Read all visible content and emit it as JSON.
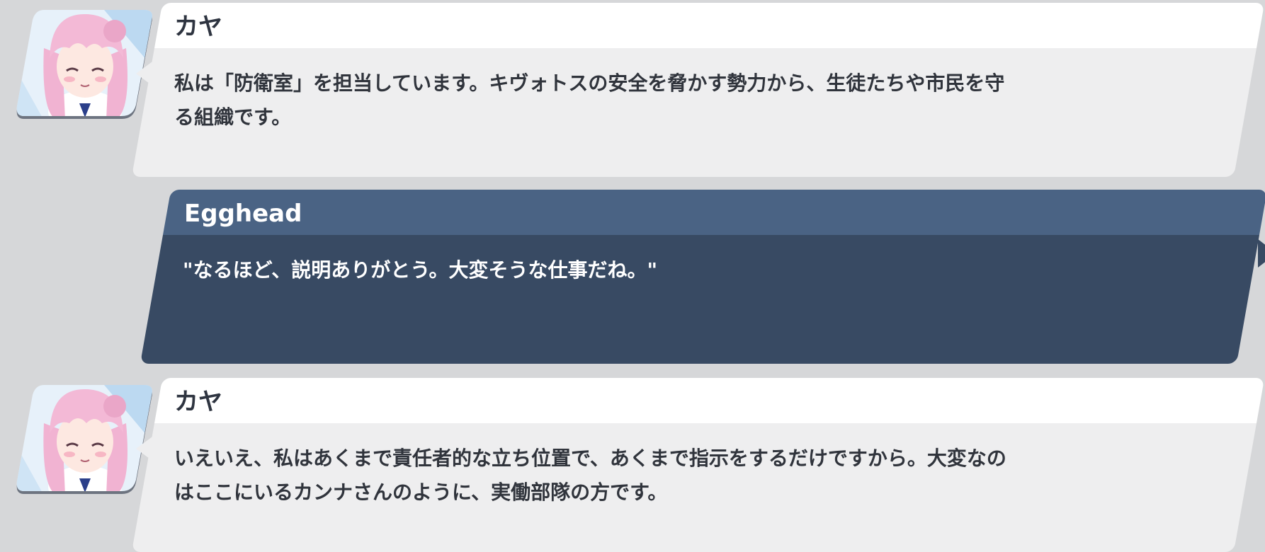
{
  "conversation": {
    "messages": [
      {
        "speaker": "カヤ",
        "role": "npc",
        "avatar_icon": "kaya-portrait-icon",
        "lines": [
          "私は「防衛室」を担当しています。キヴォトスの安全を脅かす勢力から、生徒たちや市民を守",
          "る組織です。"
        ]
      },
      {
        "speaker": "Egghead",
        "role": "player",
        "lines": [
          "\"なるほど、説明ありがとう。大変そうな仕事だね。\""
        ]
      },
      {
        "speaker": "カヤ",
        "role": "npc",
        "avatar_icon": "kaya-portrait-icon",
        "lines": [
          "いえいえ、私はあくまで責任者的な立ち位置で、あくまで指示をするだけですから。大変なの",
          "はここにいるカンナさんのように、実働部隊の方です。"
        ]
      }
    ]
  },
  "colors": {
    "background": "#d6d7d9",
    "npc_header": "#ffffff",
    "npc_body": "#eeeeef",
    "player_header": "#4a6384",
    "player_body": "#384a63",
    "hair": "#f3b9d6"
  }
}
